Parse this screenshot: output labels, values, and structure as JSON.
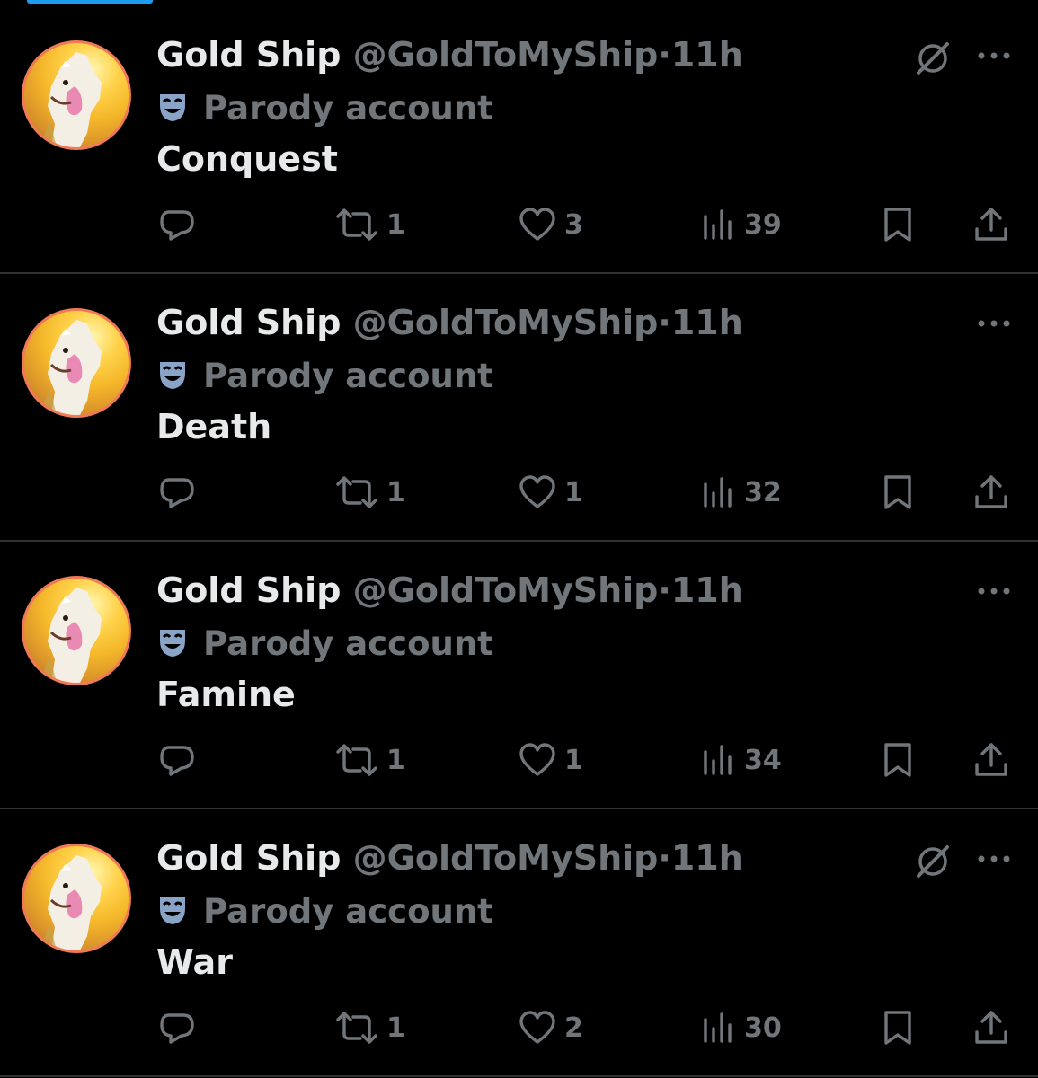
{
  "tweets": [
    {
      "display_name": "Gold Ship",
      "handle": "@GoldToMyShip",
      "dot": "·",
      "time": "11h",
      "label": "Parody account",
      "text": "Conquest",
      "retweets": "1",
      "likes": "3",
      "views": "39",
      "show_grok": true
    },
    {
      "display_name": "Gold Ship",
      "handle": "@GoldToMyShip",
      "dot": "·",
      "time": "11h",
      "label": "Parody account",
      "text": "Death",
      "retweets": "1",
      "likes": "1",
      "views": "32",
      "show_grok": false
    },
    {
      "display_name": "Gold Ship",
      "handle": "@GoldToMyShip",
      "dot": "·",
      "time": "11h",
      "label": "Parody account",
      "text": "Famine",
      "retweets": "1",
      "likes": "1",
      "views": "34",
      "show_grok": false
    },
    {
      "display_name": "Gold Ship",
      "handle": "@GoldToMyShip",
      "dot": "·",
      "time": "11h",
      "label": "Parody account",
      "text": "War",
      "retweets": "1",
      "likes": "2",
      "views": "30",
      "show_grok": true
    }
  ],
  "theme": {
    "background": "#000000",
    "text_primary": "#e7e9ea",
    "text_secondary": "#71767b",
    "divider": "#2f3336",
    "accent": "#1d9bf0",
    "avatar_border": "#f07a55"
  },
  "icons": {
    "avatar": "horse-avatar-icon",
    "parody": "theater-mask-icon",
    "grok": "grok-icon",
    "more": "more-icon",
    "reply": "reply-icon",
    "retweet": "retweet-icon",
    "like": "heart-icon",
    "views": "views-icon",
    "bookmark": "bookmark-icon",
    "share": "share-icon"
  }
}
